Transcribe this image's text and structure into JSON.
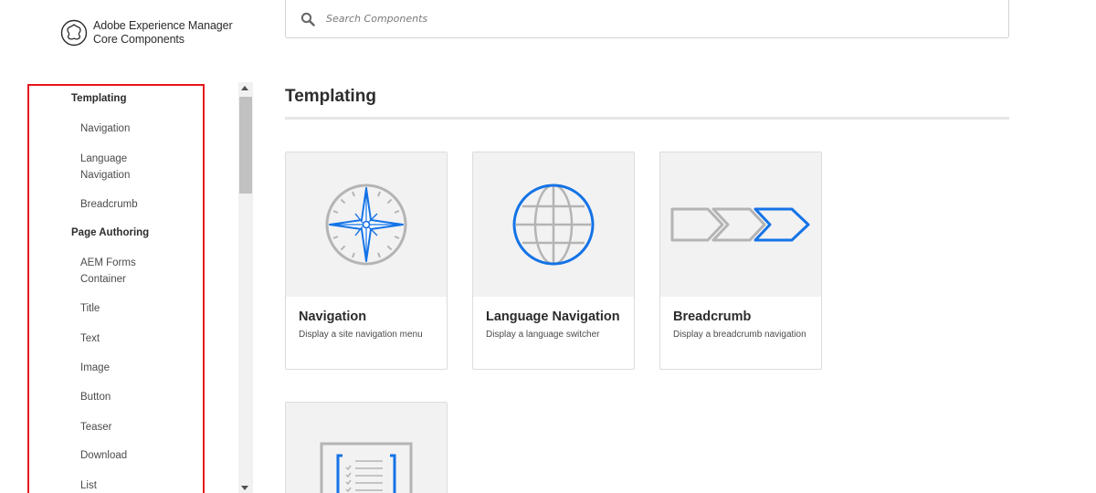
{
  "logo": {
    "line1": "Adobe Experience Manager",
    "line2": "Core Components"
  },
  "search": {
    "placeholder": "Search Components"
  },
  "sidebar": {
    "highlight_color": "#e8141b",
    "groups": [
      {
        "label": "Templating"
      },
      {
        "label": "Page Authoring"
      }
    ],
    "items": [
      {
        "label": "Navigation"
      },
      {
        "label": "Language Navigation"
      },
      {
        "label": "Breadcrumb"
      },
      {
        "label": "AEM Forms Container"
      },
      {
        "label": "Title"
      },
      {
        "label": "Text"
      },
      {
        "label": "Image"
      },
      {
        "label": "Button"
      },
      {
        "label": "Teaser"
      },
      {
        "label": "Download"
      },
      {
        "label": "List"
      }
    ]
  },
  "main": {
    "section_title": "Templating",
    "accent_color": "#1473e6",
    "cards": [
      {
        "title": "Navigation",
        "description": "Display a site navigation menu",
        "icon": "compass-icon"
      },
      {
        "title": "Language Navigation",
        "description": "Display a language switcher",
        "icon": "globe-icon"
      },
      {
        "title": "Breadcrumb",
        "description": "Display a breadcrumb navigation",
        "icon": "breadcrumb-arrows-icon"
      },
      {
        "title": "",
        "description": "",
        "icon": "form-checklist-icon"
      }
    ]
  }
}
